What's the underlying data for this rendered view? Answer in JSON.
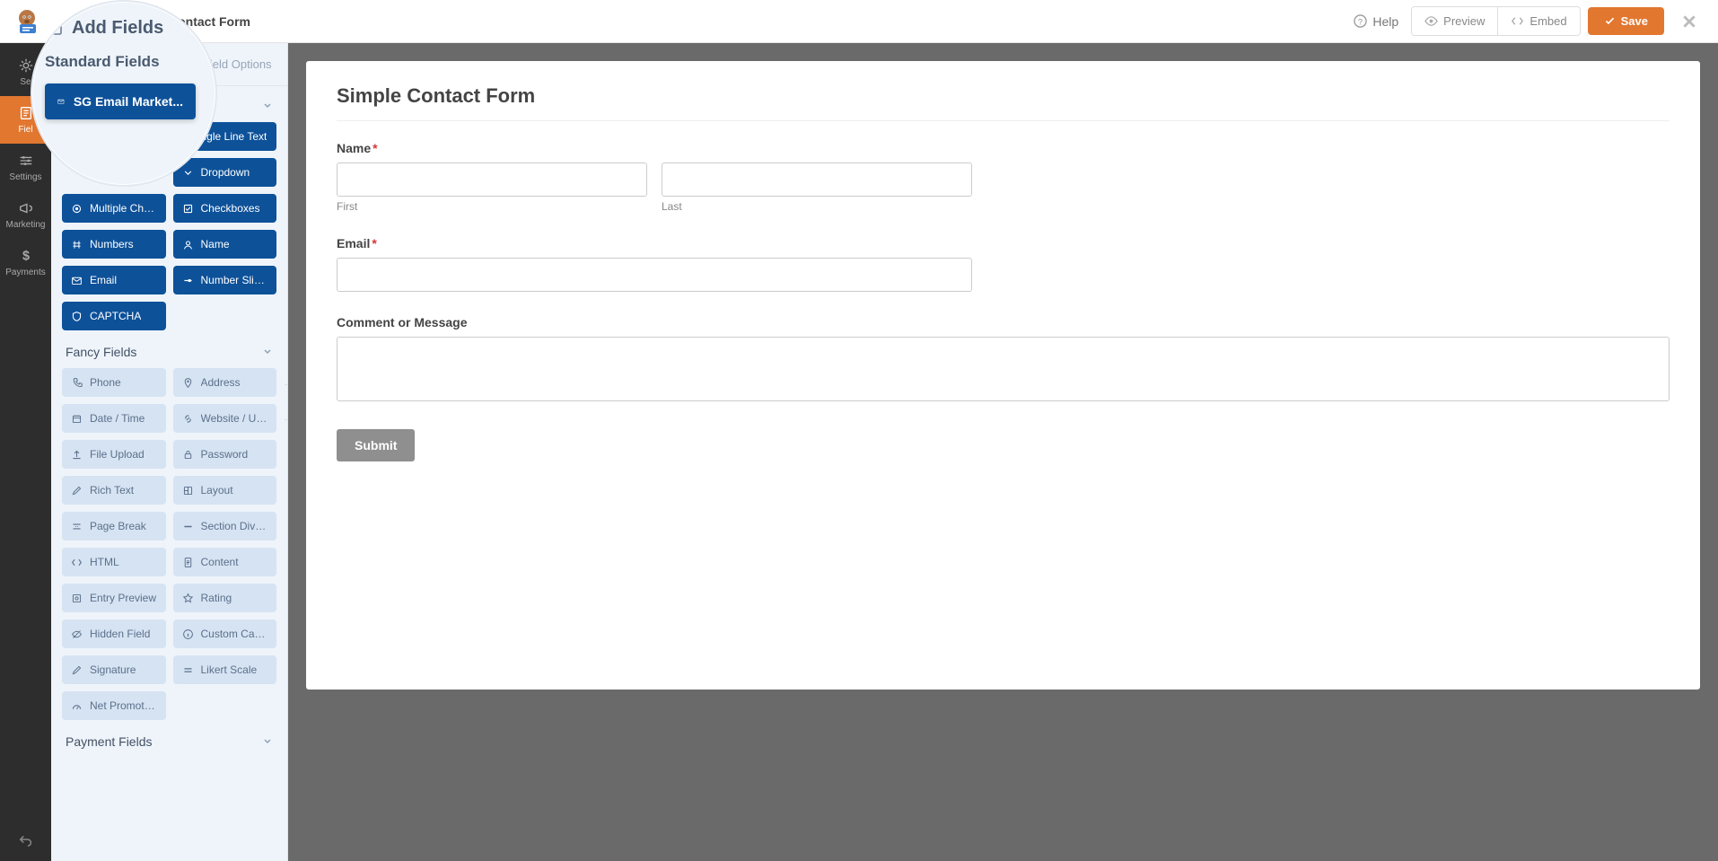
{
  "topbar": {
    "form_name": "Contact Form",
    "help_label": "Help",
    "preview_label": "Preview",
    "embed_label": "Embed",
    "save_label": "Save"
  },
  "vnav": {
    "setup": "Se",
    "fields": "Fiel",
    "settings": "Settings",
    "marketing": "Marketing",
    "payments": "Payments"
  },
  "sidebar": {
    "tabs": {
      "add_fields": "Add Fields",
      "field_options": "Field Options"
    },
    "groups": {
      "standard": "Standard Fields",
      "fancy": "Fancy Fields",
      "payment": "Payment Fields"
    },
    "standard_fields": [
      {
        "label": "SG Email Market...",
        "icon": "envelope"
      },
      {
        "label": "ngle Line Text",
        "icon": "text"
      },
      {
        "label": "Dropdown",
        "icon": "caret"
      },
      {
        "label": "Multiple Choice",
        "icon": "radio"
      },
      {
        "label": "Checkboxes",
        "icon": "check"
      },
      {
        "label": "Numbers",
        "icon": "hash"
      },
      {
        "label": "Name",
        "icon": "user"
      },
      {
        "label": "Email",
        "icon": "envelope"
      },
      {
        "label": "Number Slider",
        "icon": "slider"
      },
      {
        "label": "CAPTCHA",
        "icon": "shield"
      }
    ],
    "fancy_fields": [
      {
        "label": "Phone",
        "icon": "phone"
      },
      {
        "label": "Address",
        "icon": "pin"
      },
      {
        "label": "Date / Time",
        "icon": "calendar"
      },
      {
        "label": "Website / URL",
        "icon": "link"
      },
      {
        "label": "File Upload",
        "icon": "upload"
      },
      {
        "label": "Password",
        "icon": "lock"
      },
      {
        "label": "Rich Text",
        "icon": "edit"
      },
      {
        "label": "Layout",
        "icon": "layout"
      },
      {
        "label": "Page Break",
        "icon": "pagebreak"
      },
      {
        "label": "Section Divider",
        "icon": "divider"
      },
      {
        "label": "HTML",
        "icon": "code"
      },
      {
        "label": "Content",
        "icon": "doc"
      },
      {
        "label": "Entry Preview",
        "icon": "preview"
      },
      {
        "label": "Rating",
        "icon": "star"
      },
      {
        "label": "Hidden Field",
        "icon": "hidden"
      },
      {
        "label": "Custom Captcha",
        "icon": "info"
      },
      {
        "label": "Signature",
        "icon": "pencil"
      },
      {
        "label": "Likert Scale",
        "icon": "scale"
      },
      {
        "label": "Net Promoter Sc...",
        "icon": "gauge"
      }
    ]
  },
  "magnifier": {
    "title": "Add Fields",
    "subtitle": "Standard Fields",
    "highlight_button": "SG Email Market..."
  },
  "form": {
    "title": "Simple Contact Form",
    "name_label": "Name",
    "first_sub": "First",
    "last_sub": "Last",
    "email_label": "Email",
    "comment_label": "Comment or Message",
    "submit_label": "Submit"
  }
}
